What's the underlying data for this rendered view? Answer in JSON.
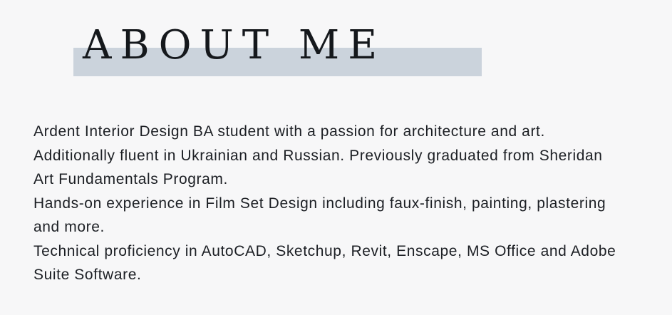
{
  "section": {
    "title": "ABOUT ME"
  },
  "about": {
    "paragraphs": [
      "Ardent Interior Design BA student with a passion for architecture and art.",
      "Additionally fluent in Ukrainian and Russian. Previously graduated from Sheridan Art Fundamentals Program.",
      "Hands-on experience in Film Set Design including faux-finish, painting, plastering and more.",
      "Technical proficiency in AutoCAD, Sketchup, Revit, Enscape, MS Office and Adobe Suite Software."
    ]
  },
  "colors": {
    "background": "#f7f7f8",
    "title_band": "#cbd3dc",
    "text": "#1c1f24"
  }
}
